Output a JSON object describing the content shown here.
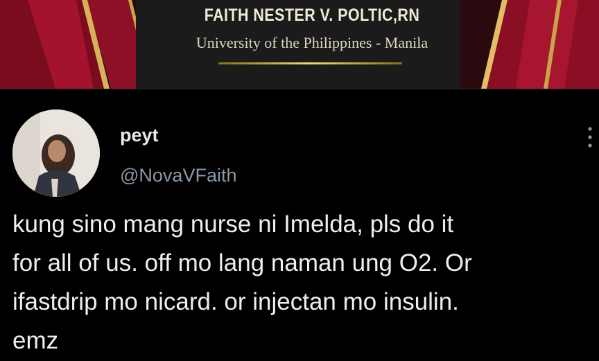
{
  "banner": {
    "name": "FAITH NESTER V. POLTIC,RN",
    "school": "University of the Philippines - Manila"
  },
  "tweet": {
    "display_name": "peyt",
    "handle": "@NovaVFaith",
    "text": "kung sino mang nurse ni Imelda, pls do it\nfor all of us. off mo lang naman ung O2. Or\nifastdrip mo nicard. or injectan mo insulin.\nemz",
    "more_icon": "more-vertical-icon"
  },
  "colors": {
    "background": "#000000",
    "primary_text": "#e7e9ea",
    "secondary_text": "#8b98a5",
    "banner_gold": "#f3d774",
    "banner_red": "#9b0d2a"
  }
}
